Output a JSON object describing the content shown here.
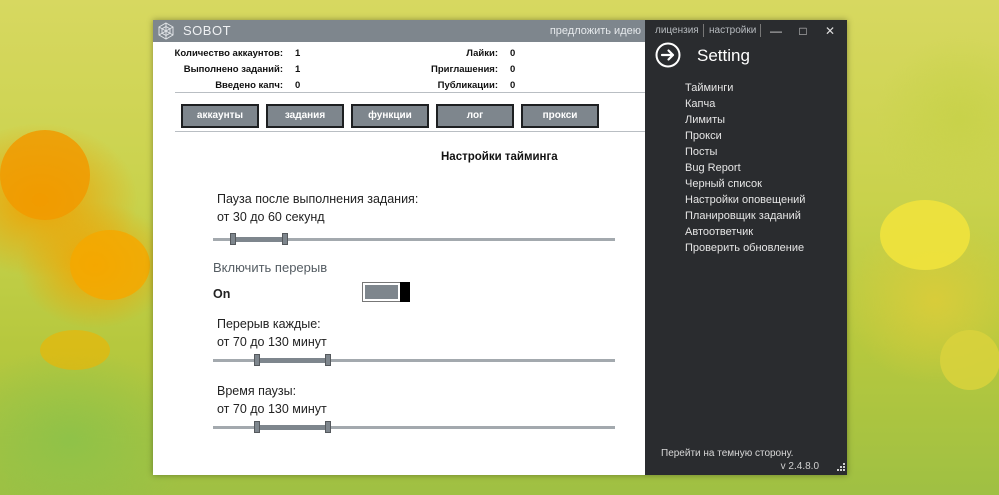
{
  "window": {
    "app_title": "SOBOT",
    "suggest_link": "предложить идею",
    "license_link": "лицензия",
    "settings_link": "настройки",
    "minimize_icon": "minimize-icon",
    "maximize_icon": "maximize-icon",
    "close_icon": "close-icon"
  },
  "stats_left": [
    {
      "label": "Количество аккаунтов:",
      "value": "1"
    },
    {
      "label": "Выполнено заданий:",
      "value": "1"
    },
    {
      "label": "Введено капч:",
      "value": "0"
    }
  ],
  "stats_right": [
    {
      "label": "Лайки:",
      "value": "0"
    },
    {
      "label": "Приглашения:",
      "value": "0"
    },
    {
      "label": "Публикации:",
      "value": "0"
    }
  ],
  "tabs": [
    "аккаунты",
    "задания",
    "функции",
    "лог",
    "прокси"
  ],
  "timing": {
    "title": "Настройки тайминга",
    "pause_label": "Пауза после выполнения задания:",
    "pause_value": "от 30 до 60 секунд",
    "pause_range": [
      0.05,
      0.18
    ],
    "break_label": "Включить перерыв",
    "break_state": "On",
    "break_enabled": true,
    "interval_label": "Перерыв каждые:",
    "interval_value": "от 70 до 130 минут",
    "interval_range": [
      0.11,
      0.285
    ],
    "duration_label": "Время паузы:",
    "duration_value": "от 70 до 130 минут",
    "duration_range": [
      0.11,
      0.285
    ]
  },
  "side": {
    "title": "Setting",
    "back_icon": "arrow-right-circle-icon",
    "menu": [
      "Тайминги",
      "Капча",
      "Лимиты",
      "Прокси",
      "Посты",
      "Bug Report",
      "Черный список",
      "Настройки оповещений",
      "Планировщик заданий",
      "Автоответчик",
      "Проверить обновление"
    ],
    "dark_link": "Перейти на темную сторону.",
    "version": "v 2.4.8.0"
  },
  "colors": {
    "accent_grey": "#7e868d",
    "side_bg": "#2a2c2f",
    "toggle_knob": "#000000"
  }
}
